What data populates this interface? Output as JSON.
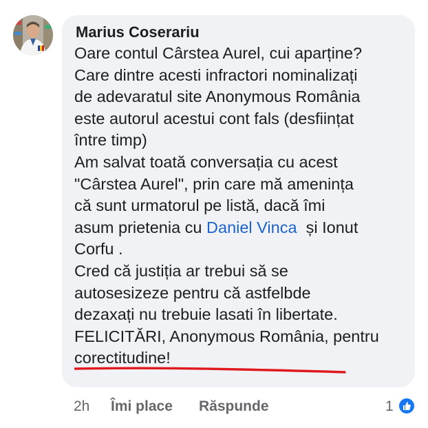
{
  "comment": {
    "author": "Marius Coserariu",
    "lines": [
      "Oare contul Cârstea Aurel, cui aparține?",
      "Care dintre acesti infractori nominalizați",
      "de adevaratul site Anonymous România",
      "este autorul acestui cont fals (desființat",
      "între timp)",
      "Am salvat toată conversația cu acest",
      "\"Cârstea Aurel\", prin care mă amenința",
      "că sunt urmatorul pe listă, dacă îmi"
    ],
    "line9_before": "asum prietenia cu ",
    "mention": "Daniel Vinca",
    "line9_after": "  și Ionut",
    "lines_after": [
      "Corfu .",
      "Cred că justiția ar trebui să se",
      "autosesizeze pentru că astfelbde",
      "dezaxați nu trebuie lasati în libertate."
    ],
    "line14_underlined": "FELICITĂRI, Anonymous România",
    "line14_rest": ", pentru",
    "line15": "corectitudine!"
  },
  "footer": {
    "time": "2h",
    "like_label": "Îmi place",
    "reply_label": "Răspunde",
    "reaction_count": "1"
  },
  "colors": {
    "bubble": "#f0f2f5",
    "mention": "#1d63c9",
    "underline": "#e0191f",
    "like_badge": "#1877f2"
  },
  "icons": {
    "avatar": "profile-photo",
    "reaction": "thumbs-up-icon"
  }
}
